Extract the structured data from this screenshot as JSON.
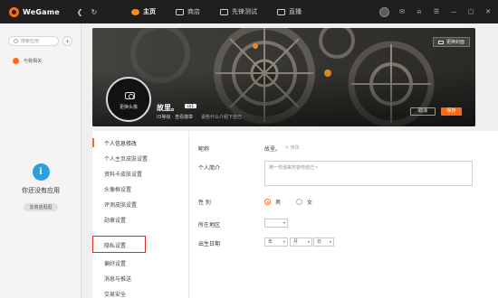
{
  "topbar": {
    "logo_text": "WeGame",
    "back_glyph": "❮",
    "refresh_glyph": "↻",
    "tabs": [
      {
        "label": "主页",
        "icon": "home-icon"
      },
      {
        "label": "商店",
        "icon": "shop-icon"
      },
      {
        "label": "先锋测试",
        "icon": "test-icon"
      },
      {
        "label": "直播",
        "icon": "live-icon"
      }
    ],
    "window_glyphs": {
      "mail": "✉",
      "bell": "⍾",
      "menu": "☰",
      "minimize": "—",
      "maximize": "▢",
      "close": "✕"
    }
  },
  "sidebar": {
    "search_placeholder": "搜索应用",
    "add_glyph": "+",
    "related_label": "与我相关",
    "empty_text": "你还没有应用",
    "empty_button": "去商店逛逛",
    "info_glyph": "i"
  },
  "banner": {
    "change_bg_label": "更换封面",
    "avatar_label": "更换头像",
    "name": "故里。",
    "level": "LV1",
    "id_text": "ID等级 · 查看徽章",
    "signature": "说些什么介绍下自己",
    "cancel_label": "取消",
    "save_label": "保存"
  },
  "menu": {
    "items": [
      "个人信息修改",
      "个人主页皮肤设置",
      "资料卡皮肤设置",
      "头像框设置",
      "评测皮肤设置",
      "勋章设置",
      "隐私设置",
      "偏好设置",
      "消息与推送",
      "交易安全"
    ],
    "active_index": 0,
    "highlighted_index": 6
  },
  "form": {
    "nickname_label": "昵称",
    "nickname_value": "故里。",
    "edit_label": "✎ 修改",
    "intro_label": "个人简介",
    "intro_placeholder": "用一句话来形容你自己~",
    "gender_label": "性 别",
    "male_label": "男",
    "female_label": "女",
    "gender_selected": "男",
    "region_label": "所在地区",
    "region_value": "",
    "birthday_label": "出生日期",
    "year_placeholder": "年",
    "month_placeholder": "月",
    "day_placeholder": "日",
    "caret_glyph": "▾"
  },
  "colors": {
    "accent": "#ff6a13",
    "highlight": "#e32a2a",
    "topbar": "#1f1f1f",
    "info": "#2ca0de"
  }
}
